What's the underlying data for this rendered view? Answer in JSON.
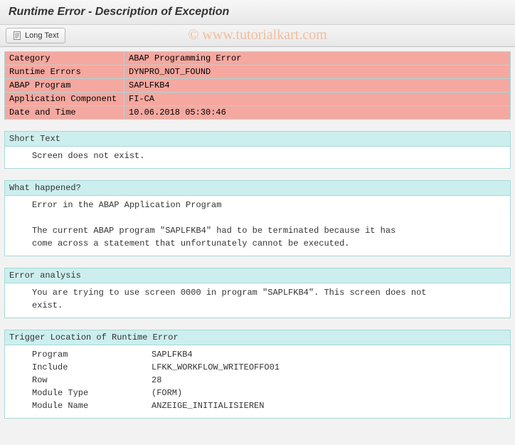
{
  "title": "Runtime Error - Description of Exception",
  "toolbar": {
    "long_text_label": "Long Text"
  },
  "watermark": "© www.tutorialkart.com",
  "info": {
    "rows": [
      {
        "label": "Category",
        "value": "ABAP Programming Error"
      },
      {
        "label": "Runtime Errors",
        "value": "DYNPRO_NOT_FOUND"
      },
      {
        "label": "ABAP Program",
        "value": "SAPLFKB4"
      },
      {
        "label": "Application Component",
        "value": "FI-CA"
      },
      {
        "label": "Date and Time",
        "value": "10.06.2018 05:30:46"
      }
    ]
  },
  "sections": {
    "short_text": {
      "header": "Short Text",
      "lines": [
        "Screen does not exist."
      ]
    },
    "what_happened": {
      "header": "What happened?",
      "lines": [
        "Error in the ABAP Application Program",
        "",
        "The current ABAP program \"SAPLFKB4\" had to be terminated because it has",
        "come across a statement that unfortunately cannot be executed."
      ]
    },
    "error_analysis": {
      "header": "Error analysis",
      "lines": [
        "You are trying to use screen 0000 in program \"SAPLFKB4\". This screen does not",
        "exist."
      ]
    },
    "trigger_location": {
      "header": "Trigger Location of Runtime Error",
      "rows": [
        {
          "label": "Program",
          "value": "SAPLFKB4"
        },
        {
          "label": "Include",
          "value": "LFKK_WORKFLOW_WRITEOFFO01"
        },
        {
          "label": "Row",
          "value": "28"
        },
        {
          "label": "Module Type",
          "value": "(FORM)"
        },
        {
          "label": "Module Name",
          "value": "ANZEIGE_INITIALISIEREN"
        }
      ]
    }
  }
}
